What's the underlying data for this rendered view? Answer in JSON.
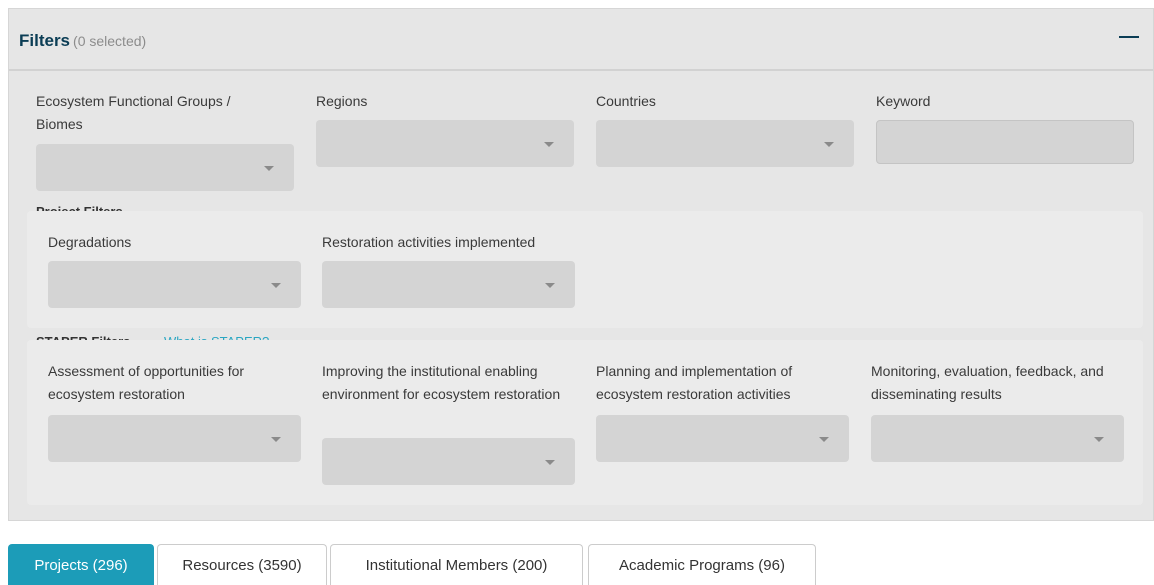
{
  "filters": {
    "title": "Filters",
    "selected_count": "(0 selected)",
    "collapse_icon": "minus-icon"
  },
  "main_filters": {
    "ecosystem_label": "Ecosystem Functional Groups / Biomes",
    "regions_label": "Regions",
    "countries_label": "Countries",
    "keyword_label": "Keyword",
    "keyword_value": ""
  },
  "project_filters": {
    "title": "Project Filters",
    "degradations_label": "Degradations",
    "restoration_label": "Restoration activities implemented"
  },
  "staper_filters": {
    "title": "STAPER Filters",
    "help_link": "What is STAPER?",
    "assessment_label": "Assessment of opportunities for ecosystem restoration",
    "institutional_label": "Improving the institutional enabling environment for ecosystem restoration",
    "planning_label": "Planning and implementation of ecosystem restoration activities",
    "monitoring_label": "Monitoring, evaluation, feedback, and disseminating results"
  },
  "tabs": [
    {
      "label": "Projects (296)",
      "active": true
    },
    {
      "label": "Resources (3590)",
      "active": false
    },
    {
      "label": "Institutional Members (200)",
      "active": false
    },
    {
      "label": "Academic Programs (96)",
      "active": false
    }
  ],
  "colors": {
    "accent": "#1c9cb8",
    "title": "#0b3d55",
    "link": "#2aa6c2"
  }
}
